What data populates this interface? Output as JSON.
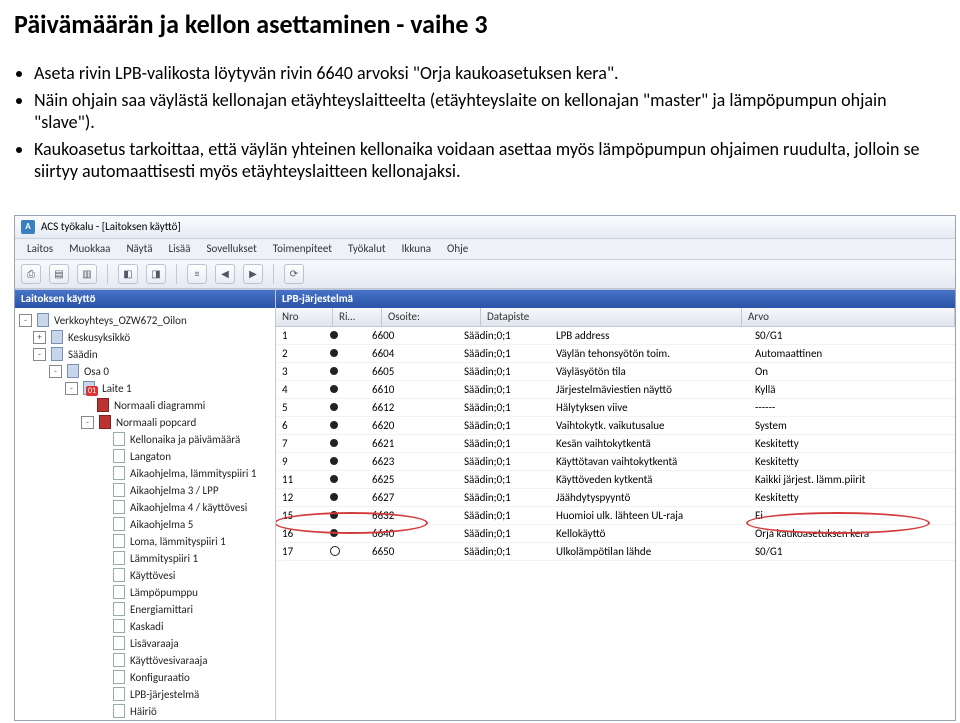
{
  "doc": {
    "heading": "Päivämäärän ja kellon asettaminen - vaihe 3",
    "bullets": [
      "Aseta rivin LPB-valikosta löytyvän rivin 6640 arvoksi \"Orja kaukoasetuksen kera\".",
      "Näin ohjain saa väylästä kellonajan etäyhteyslaitteelta (etäyhteyslaite on kellonajan \"master\" ja lämpöpumpun ohjain \"slave\").",
      "Kaukoasetus tarkoittaa, että väylän yhteinen kellonaika voidaan asettaa myös lämpöpumpun ohjaimen ruudulta, jolloin se siirtyy automaattisesti myös etäyhteyslaitteen kellonajaksi."
    ]
  },
  "app": {
    "title": "ACS työkalu - [Laitoksen käyttö]",
    "menu": [
      "Laitos",
      "Muokkaa",
      "Näytä",
      "Lisää",
      "Sovellukset",
      "Toimenpiteet",
      "Työkalut",
      "Ikkuna",
      "Ohje"
    ],
    "leftPaneTitle": "Laitoksen käyttö",
    "rightPaneTitle": "LPB-järjestelmä",
    "gridHeaders": {
      "nro": "Nro",
      "ri": "Ri…",
      "osoite": "Osoite:",
      "datapiste": "Datapiste",
      "arvo": "Arvo"
    },
    "tree": [
      {
        "level": 0,
        "exp": "-",
        "icon": "dev",
        "label": "Verkkoyhteys_OZW672_Oilon"
      },
      {
        "level": 1,
        "exp": "+",
        "icon": "dev",
        "label": "Keskusyksikkö"
      },
      {
        "level": 1,
        "exp": "-",
        "icon": "dev",
        "label": "Säädin"
      },
      {
        "level": 2,
        "exp": "-",
        "icon": "dev",
        "label": "Osa 0"
      },
      {
        "level": 3,
        "exp": "-",
        "icon": "dev",
        "label": "Laite 1",
        "badge": "01"
      },
      {
        "level": 4,
        "exp": "",
        "icon": "red",
        "label": "Normaali diagrammi"
      },
      {
        "level": 4,
        "exp": "-",
        "icon": "red",
        "label": "Normaali popcard"
      },
      {
        "level": 5,
        "exp": "",
        "icon": "page",
        "label": "Kellonaika ja päivämäärä"
      },
      {
        "level": 5,
        "exp": "",
        "icon": "page",
        "label": "Langaton"
      },
      {
        "level": 5,
        "exp": "",
        "icon": "page",
        "label": "Aikaohjelma, lämmityspiiri 1"
      },
      {
        "level": 5,
        "exp": "",
        "icon": "page",
        "label": "Aikaohjelma 3 / LPP"
      },
      {
        "level": 5,
        "exp": "",
        "icon": "page",
        "label": "Aikaohjelma 4 / käyttövesi"
      },
      {
        "level": 5,
        "exp": "",
        "icon": "page",
        "label": "Aikaohjelma 5"
      },
      {
        "level": 5,
        "exp": "",
        "icon": "page",
        "label": "Loma, lämmityspiiri 1"
      },
      {
        "level": 5,
        "exp": "",
        "icon": "page",
        "label": "Lämmityspiiri 1"
      },
      {
        "level": 5,
        "exp": "",
        "icon": "page",
        "label": "Käyttövesi"
      },
      {
        "level": 5,
        "exp": "",
        "icon": "page",
        "label": "Lämpöpumppu"
      },
      {
        "level": 5,
        "exp": "",
        "icon": "page",
        "label": "Energiamittari"
      },
      {
        "level": 5,
        "exp": "",
        "icon": "page",
        "label": "Kaskadi"
      },
      {
        "level": 5,
        "exp": "",
        "icon": "page",
        "label": "Lisävaraaja"
      },
      {
        "level": 5,
        "exp": "",
        "icon": "page",
        "label": "Käyttövesivaraaja"
      },
      {
        "level": 5,
        "exp": "",
        "icon": "page",
        "label": "Konfiguraatio"
      },
      {
        "level": 5,
        "exp": "",
        "icon": "page",
        "label": "LPB-järjestelmä"
      },
      {
        "level": 5,
        "exp": "",
        "icon": "page",
        "label": "Häiriö"
      }
    ],
    "rows": [
      {
        "nro": "1",
        "ri": "dot",
        "osoite": "6600",
        "col": "Säädin;0;1",
        "dp": "LPB address",
        "arvo": "S0/G1"
      },
      {
        "nro": "2",
        "ri": "dot",
        "osoite": "6604",
        "col": "Säädin;0;1",
        "dp": "Väylän tehonsyötön toim.",
        "arvo": "Automaattinen"
      },
      {
        "nro": "3",
        "ri": "dot",
        "osoite": "6605",
        "col": "Säädin;0;1",
        "dp": "Väyläsyötön tila",
        "arvo": "On"
      },
      {
        "nro": "4",
        "ri": "dot",
        "osoite": "6610",
        "col": "Säädin;0;1",
        "dp": "Järjestelmäviestien näyttö",
        "arvo": "Kyllä"
      },
      {
        "nro": "5",
        "ri": "dot",
        "osoite": "6612",
        "col": "Säädin;0;1",
        "dp": "Hälytyksen viive",
        "arvo": "------"
      },
      {
        "nro": "6",
        "ri": "dot",
        "osoite": "6620",
        "col": "Säädin;0;1",
        "dp": "Vaihtokytk. vaikutusalue",
        "arvo": "System"
      },
      {
        "nro": "7",
        "ri": "dot",
        "osoite": "6621",
        "col": "Säädin;0;1",
        "dp": "Kesän vaihtokytkentä",
        "arvo": "Keskitetty"
      },
      {
        "nro": "9",
        "ri": "dot",
        "osoite": "6623",
        "col": "Säädin;0;1",
        "dp": "Käyttötavan vaihtokytkentä",
        "arvo": "Keskitetty"
      },
      {
        "nro": "11",
        "ri": "dot",
        "osoite": "6625",
        "col": "Säädin;0;1",
        "dp": "Käyttöveden kytkentä",
        "arvo": "Kaikki järjest. lämm.piirit"
      },
      {
        "nro": "12",
        "ri": "dot",
        "osoite": "6627",
        "col": "Säädin;0;1",
        "dp": "Jäähdytyspyyntö",
        "arvo": "Keskitetty"
      },
      {
        "nro": "15",
        "ri": "dot",
        "osoite": "6632",
        "col": "Säädin;0;1",
        "dp": "Huomioi ulk. lähteen UL-raja",
        "arvo": "Ei"
      },
      {
        "nro": "16",
        "ri": "dot",
        "osoite": "6640",
        "col": "Säädin;0;1",
        "dp": "Kellokäyttö",
        "arvo": "Orja kaukoasetuksen kera"
      },
      {
        "nro": "17",
        "ri": "circle",
        "osoite": "6650",
        "col": "Säädin;0;1",
        "dp": "Ulkolämpötilan lähde",
        "arvo": "S0/G1"
      }
    ]
  }
}
